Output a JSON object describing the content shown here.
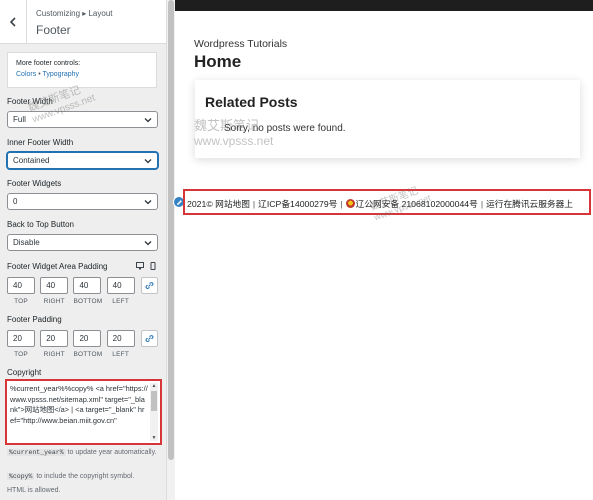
{
  "customizer": {
    "breadcrumb": "Customizing ▸ Layout",
    "section_title": "Footer",
    "more_controls": {
      "title": "More footer controls:",
      "links": [
        "Colors",
        "Typography"
      ],
      "separator": "•"
    },
    "footer_width": {
      "label": "Footer Width",
      "value": "Full"
    },
    "inner_footer_width": {
      "label": "Inner Footer Width",
      "value": "Contained"
    },
    "footer_widgets": {
      "label": "Footer Widgets",
      "value": "0"
    },
    "back_to_top": {
      "label": "Back to Top Button",
      "value": "Disable"
    },
    "widget_area_padding": {
      "label": "Footer Widget Area Padding",
      "values": [
        "40",
        "40",
        "40",
        "40"
      ],
      "captions": [
        "TOP",
        "RIGHT",
        "BOTTOM",
        "LEFT"
      ]
    },
    "footer_padding": {
      "label": "Footer Padding",
      "values": [
        "20",
        "20",
        "20",
        "20"
      ],
      "captions": [
        "TOP",
        "RIGHT",
        "BOTTOM",
        "LEFT"
      ]
    },
    "copyright": {
      "label": "Copyright",
      "value": "%current_year%%copy% <a href=\"https://www.vpsss.net/sitemap.xml\" target=\"_blank\">网站地图</a> | <a target=\"_blank\" href=\"http://www.beian.miit.gov.cn\"",
      "help1_code": "%current_year%",
      "help1_text": " to update year automatically.",
      "help2_code": "%copy%",
      "help2_text": " to include the copyright symbol.",
      "help3_text": "HTML is allowed."
    }
  },
  "preview": {
    "site_title": "Wordpress Tutorials",
    "page_title": "Home",
    "related": {
      "title": "Related Posts",
      "message": "Sorry, no posts were found."
    },
    "footer": {
      "prefix": "2021©",
      "sitemap": "网站地图",
      "divider": "|",
      "icp": "辽ICP备14000279号",
      "police": "辽公网安备 21068102000044号",
      "hosting": "运行在腾讯云服务器上"
    },
    "watermarks": {
      "w1": "魏艾斯笔记",
      "w1b": "www.vpsss.net",
      "w2": "魏艾斯笔记",
      "w2b": "www.vpsss.net",
      "w3": "魏艾斯笔记",
      "w3b": "www.vpsss.net"
    }
  },
  "colors": {
    "accent": "#2271b1",
    "highlight": "#d63638",
    "topbar": "#1e1e1e"
  }
}
